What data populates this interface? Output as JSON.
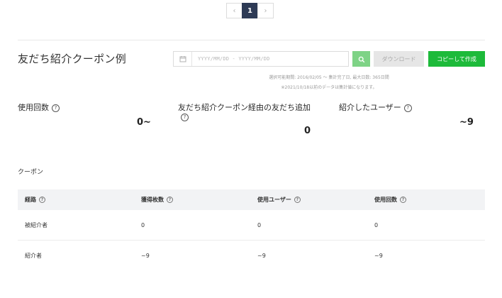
{
  "pagination": {
    "prev": "‹",
    "current": "1",
    "next": "›"
  },
  "title": "友だち紹介クーポン例",
  "date_filter": {
    "placeholder": "YYYY/MM/DD - YYYY/MM/DD"
  },
  "buttons": {
    "download": "ダウンロード",
    "copy": "コピーして作成"
  },
  "notes": {
    "range": "選択可能期間: 2016/02/05 〜 集計完了日, 最大日数: 365日間",
    "data_note": "※2021/10/18以前のデータは集計値になります。"
  },
  "stats": [
    {
      "label": "使用回数",
      "value": "0~"
    },
    {
      "label": "友だち紹介クーポン経由の友だち追加",
      "value": "0"
    },
    {
      "label": "紹介したユーザー",
      "value": "~9"
    }
  ],
  "section_title": "クーポン",
  "table": {
    "headers": [
      "経路",
      "獲得枚数",
      "使用ユーザー",
      "使用回数"
    ],
    "rows": [
      [
        "被紹介者",
        "0",
        "0",
        "0"
      ],
      [
        "紹介者",
        "~9",
        "~9",
        "~9"
      ]
    ]
  },
  "colors": {
    "primary": "#1dba3a",
    "search": "#7ed386",
    "pager_active": "#2d3a55"
  }
}
